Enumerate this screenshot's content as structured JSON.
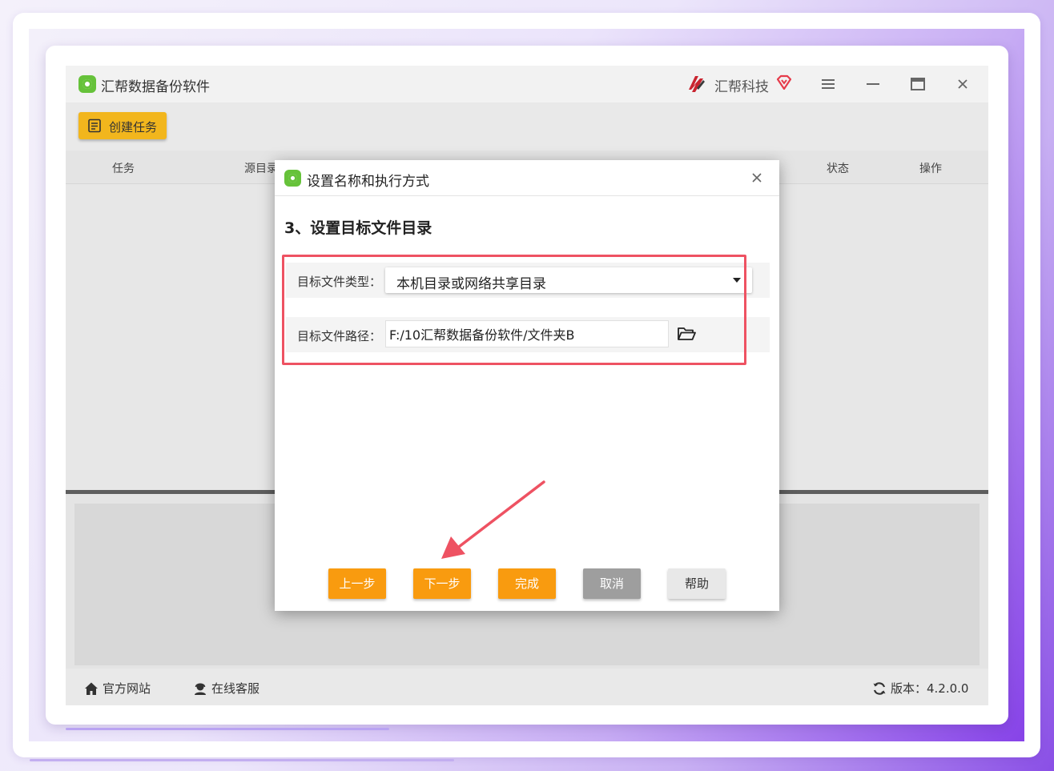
{
  "app": {
    "title": "汇帮数据备份软件",
    "brand": "汇帮科技",
    "window_controls": [
      "menu-icon",
      "minimize-icon",
      "maximize-icon",
      "close-icon"
    ]
  },
  "toolbar": {
    "create_task_label": "创建任务"
  },
  "table": {
    "columns": [
      "任务",
      "源目录",
      "状态",
      "操作"
    ]
  },
  "statusbar": {
    "website_label": "官方网站",
    "support_label": "在线客服",
    "version_label": "版本：4.2.0.0"
  },
  "dialog": {
    "title": "设置名称和执行方式",
    "step_title": "3、设置目标文件目录",
    "target_type_label": "目标文件类型：",
    "target_type_value": "本机目录或网络共享目录",
    "target_path_label": "目标文件路径：",
    "target_path_value": "F:/10汇帮数据备份软件/文件夹B",
    "buttons": {
      "prev": "上一步",
      "next": "下一步",
      "finish": "完成",
      "cancel": "取消",
      "help": "帮助"
    }
  },
  "colors": {
    "accent_orange": "#f99b0f",
    "create_button": "#f2b61d",
    "logo_green": "#66c23a",
    "annotation_red": "#ee5262"
  }
}
